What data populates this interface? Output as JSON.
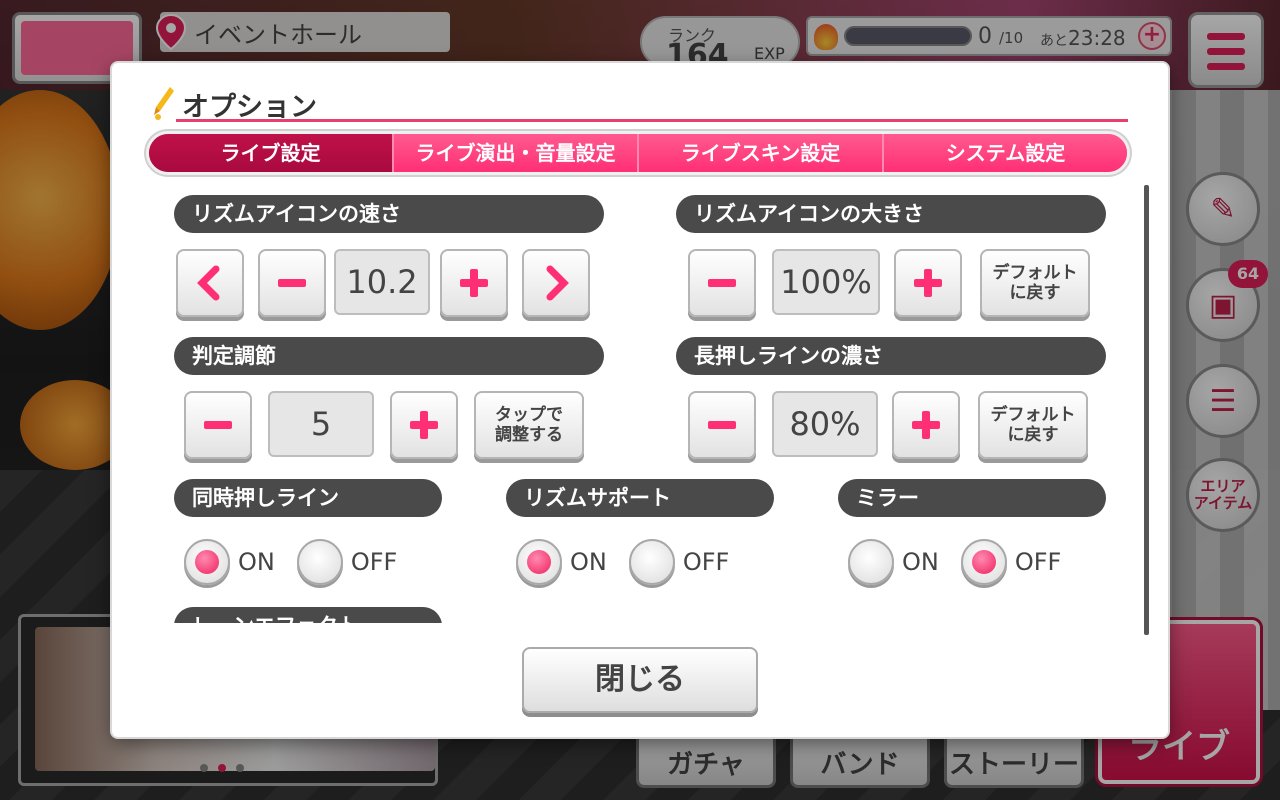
{
  "hud": {
    "location": "イベントホール",
    "rank_label": "ランク",
    "rank_value": "164",
    "exp_label": "EXP",
    "stamina_current": "0",
    "stamina_max": "/10",
    "stamina_timer_prefix": "あと",
    "stamina_timer": "23:28",
    "gift_badge": "64",
    "area_item_label_1": "エリア",
    "area_item_label_2": "アイテム"
  },
  "bottom_nav": {
    "gacha": "ガチャ",
    "band": "バンド",
    "story": "ストーリー",
    "live": "ライブ"
  },
  "dialog": {
    "title": "オプション",
    "tabs": [
      {
        "label": "ライブ設定",
        "active": true
      },
      {
        "label": "ライブ演出・音量設定",
        "active": false
      },
      {
        "label": "ライブスキン設定",
        "active": false
      },
      {
        "label": "システム設定",
        "active": false
      }
    ],
    "rhythm_icon_speed": {
      "label": "リズムアイコンの速さ",
      "value": "10.2"
    },
    "rhythm_icon_size": {
      "label": "リズムアイコンの大きさ",
      "value": "100%",
      "default_button": "デフォルト\nに戻す"
    },
    "judgement_adjust": {
      "label": "判定調節",
      "value": "5",
      "tap_button": "タップで\n調整する"
    },
    "long_line_density": {
      "label": "長押しラインの濃さ",
      "value": "80%",
      "default_button": "デフォルト\nに戻す"
    },
    "simultaneous_line": {
      "label": "同時押しライン",
      "on": "ON",
      "off": "OFF",
      "selected": "ON"
    },
    "rhythm_support": {
      "label": "リズムサポート",
      "on": "ON",
      "off": "OFF",
      "selected": "ON"
    },
    "mirror": {
      "label": "ミラー",
      "on": "ON",
      "off": "OFF",
      "selected": "OFF"
    },
    "next_section_label": "レーンエフェクト",
    "close_button": "閉じる"
  },
  "colors": {
    "accent": "#ff2f75",
    "tab_active": "#b00c44",
    "section_label_bg": "#4a4a4a"
  }
}
